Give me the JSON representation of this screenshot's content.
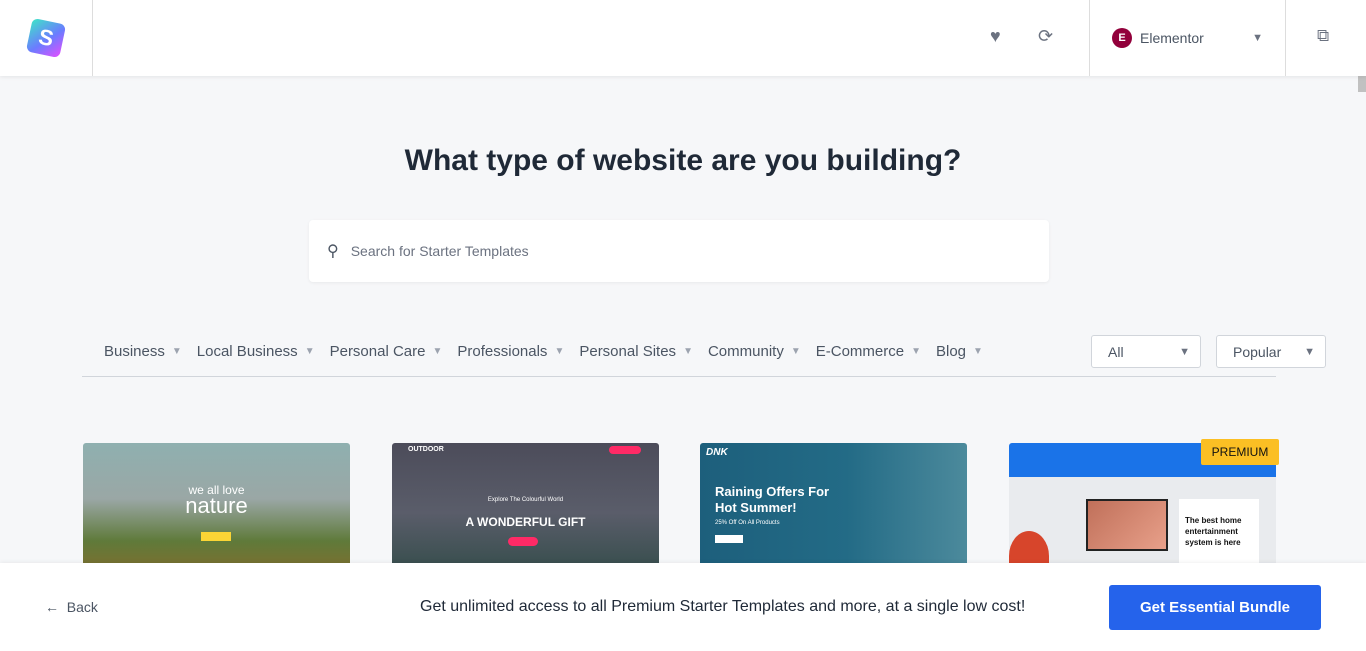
{
  "header": {
    "logo_letter": "S",
    "builder_label": "Elementor",
    "builder_icon": "E"
  },
  "main": {
    "title": "What type of website are you building?",
    "search_placeholder": "Search for Starter Templates",
    "categories": [
      "Business",
      "Local Business",
      "Personal Care",
      "Professionals",
      "Personal Sites",
      "Community",
      "E-Commerce",
      "Blog"
    ],
    "type_filter": "All",
    "sort_filter": "Popular"
  },
  "templates": [
    {
      "tagline": "we all love",
      "headline": "nature"
    },
    {
      "brand": "OUTDOOR",
      "tagline": "Explore The Colourful World",
      "headline": "A WONDERFUL GIFT"
    },
    {
      "brand": "DNK",
      "headline": "Raining Offers For Hot Summer!",
      "tagline": "25% Off On All Products"
    },
    {
      "badge": "PREMIUM",
      "headline": "The best home entertainment system is here"
    }
  ],
  "footer": {
    "back_label": "Back",
    "promo": "Get unlimited access to all Premium Starter Templates and more, at a single low cost!",
    "cta": "Get Essential Bundle"
  },
  "colors": {
    "accent": "#2563eb",
    "premium": "#fbbf24",
    "elementor": "#92003b"
  }
}
